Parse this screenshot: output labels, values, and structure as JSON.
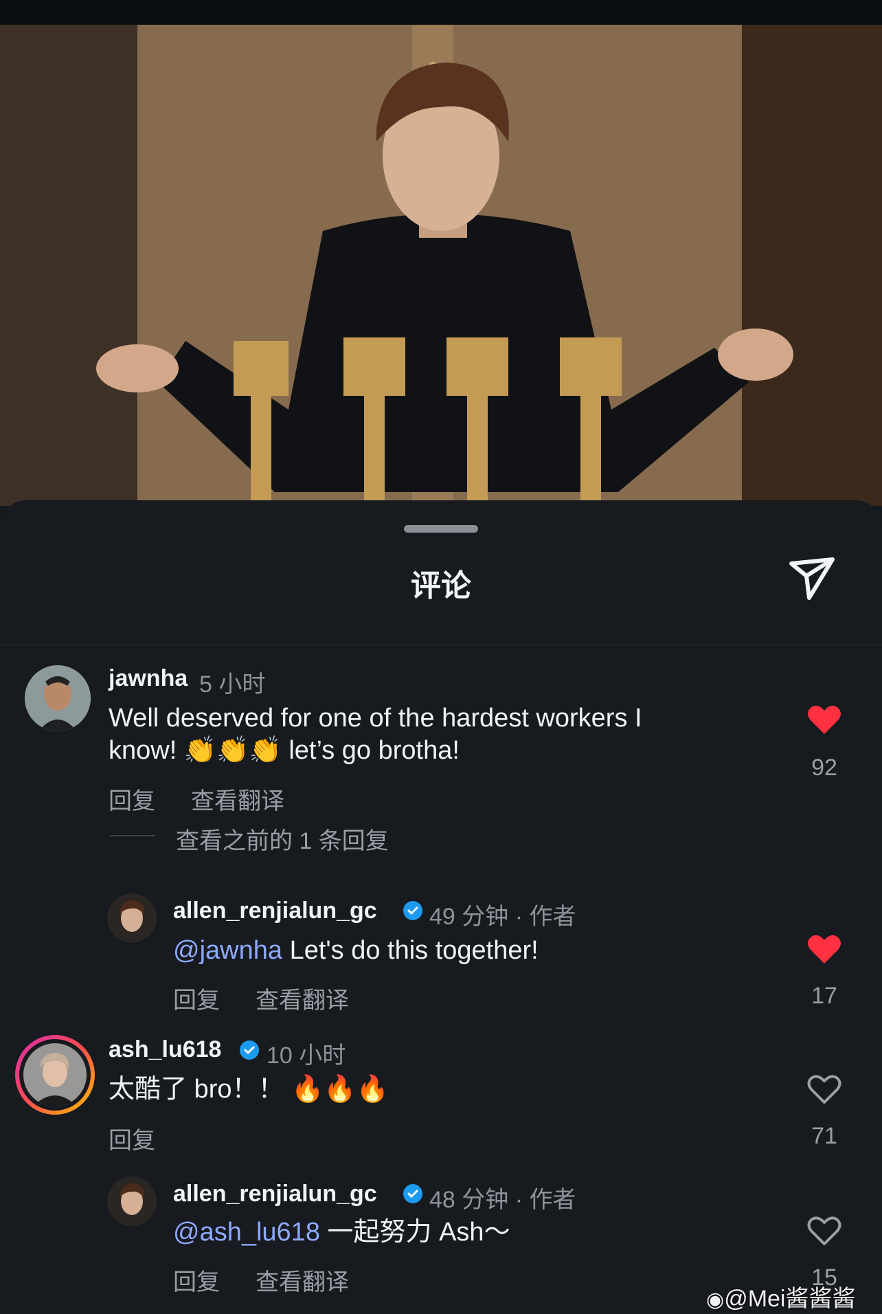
{
  "sheet": {
    "title": "评论"
  },
  "comments": [
    {
      "username": "jawnha",
      "time": "5 小时",
      "text_line1": "Well deserved for one of the hardest workers I",
      "text_line2": "know! 👏👏👏 let’s go brotha!",
      "reply_label": "回复",
      "translate_label": "查看翻译",
      "likes": "92",
      "liked": true,
      "view_previous": "查看之前的 1 条回复"
    },
    {
      "username": "allen_renjialun_gc",
      "verified": true,
      "time": "49 分钟 · 作者",
      "mention": "@jawnha",
      "text": "Let's do this together!",
      "reply_label": "回复",
      "translate_label": "查看翻译",
      "likes": "17",
      "liked": true
    },
    {
      "username": "ash_lu618",
      "verified": true,
      "time": "10 小时",
      "text": "太酷了 bro！！ 🔥🔥🔥",
      "reply_label": "回复",
      "likes": "71",
      "liked": false
    },
    {
      "username": "allen_renjialun_gc",
      "verified": true,
      "time": "48 分钟 · 作者",
      "mention": "@ash_lu618",
      "text": "一起努力 Ash～",
      "reply_label": "回复",
      "translate_label": "查看翻译",
      "likes": "15",
      "liked": false
    }
  ],
  "watermark": "@Mei酱酱酱",
  "colors": {
    "like_red": "#ff3040",
    "mention_blue": "#8da9ff",
    "verified_blue": "#1d9bf0"
  }
}
